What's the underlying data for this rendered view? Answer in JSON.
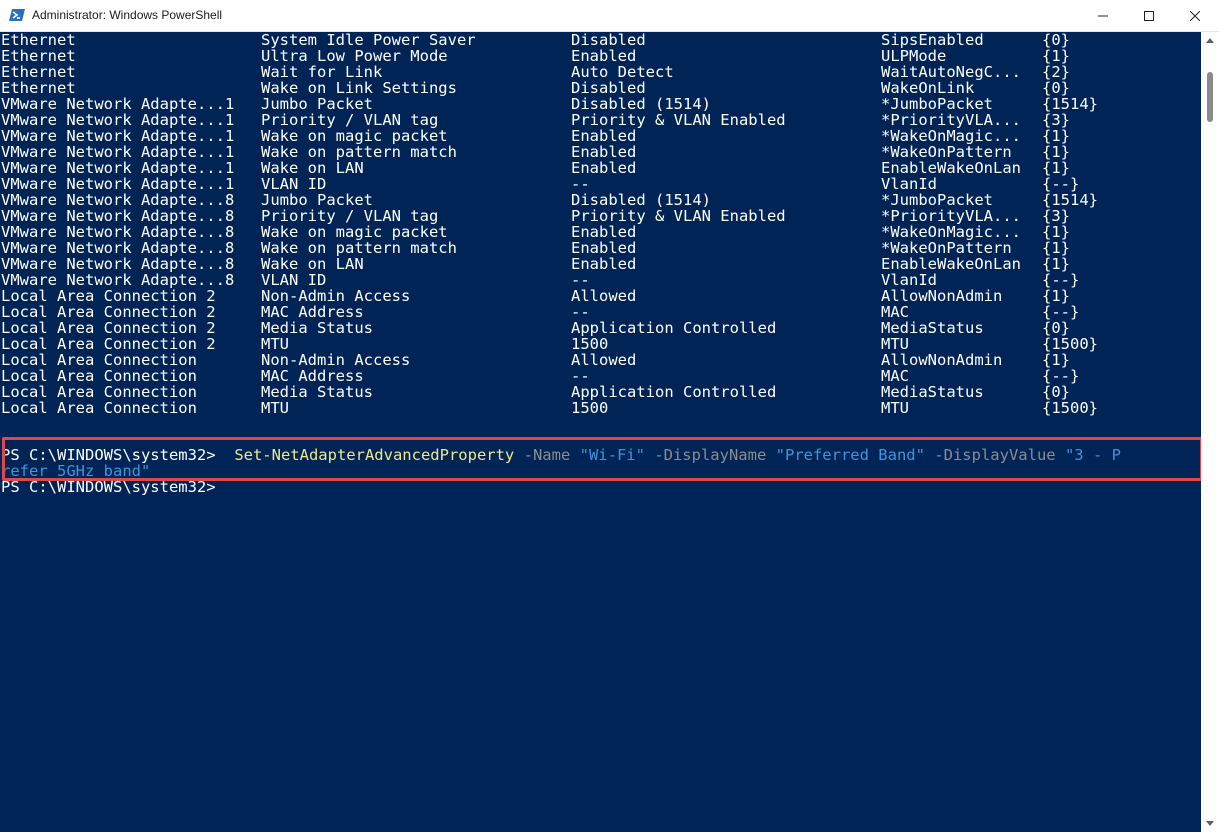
{
  "window": {
    "title": "Administrator: Windows PowerShell",
    "icon": "powershell-icon",
    "controls": [
      "minimize-icon",
      "maximize-icon",
      "close-icon"
    ]
  },
  "colors": {
    "background": "#012456",
    "text": "#ffffff",
    "cmdlet": "#f0e68c",
    "parameter": "#8c8c8c",
    "string": "#3a96dd",
    "highlight_border": "#e0474b"
  },
  "output_rows": [
    [
      "Ethernet",
      "System Idle Power Saver",
      "Disabled",
      "SipsEnabled",
      "{0}"
    ],
    [
      "Ethernet",
      "Ultra Low Power Mode",
      "Enabled",
      "ULPMode",
      "{1}"
    ],
    [
      "Ethernet",
      "Wait for Link",
      "Auto Detect",
      "WaitAutoNegC...",
      "{2}"
    ],
    [
      "Ethernet",
      "Wake on Link Settings",
      "Disabled",
      "WakeOnLink",
      "{0}"
    ],
    [
      "VMware Network Adapte...1",
      "Jumbo Packet",
      "Disabled (1514)",
      "*JumboPacket",
      "{1514}"
    ],
    [
      "VMware Network Adapte...1",
      "Priority / VLAN tag",
      "Priority & VLAN Enabled",
      "*PriorityVLA...",
      "{3}"
    ],
    [
      "VMware Network Adapte...1",
      "Wake on magic packet",
      "Enabled",
      "*WakeOnMagic...",
      "{1}"
    ],
    [
      "VMware Network Adapte...1",
      "Wake on pattern match",
      "Enabled",
      "*WakeOnPattern",
      "{1}"
    ],
    [
      "VMware Network Adapte...1",
      "Wake on LAN",
      "Enabled",
      "EnableWakeOnLan",
      "{1}"
    ],
    [
      "VMware Network Adapte...1",
      "VLAN ID",
      "--",
      "VlanId",
      "{--}"
    ],
    [
      "VMware Network Adapte...8",
      "Jumbo Packet",
      "Disabled (1514)",
      "*JumboPacket",
      "{1514}"
    ],
    [
      "VMware Network Adapte...8",
      "Priority / VLAN tag",
      "Priority & VLAN Enabled",
      "*PriorityVLA...",
      "{3}"
    ],
    [
      "VMware Network Adapte...8",
      "Wake on magic packet",
      "Enabled",
      "*WakeOnMagic...",
      "{1}"
    ],
    [
      "VMware Network Adapte...8",
      "Wake on pattern match",
      "Enabled",
      "*WakeOnPattern",
      "{1}"
    ],
    [
      "VMware Network Adapte...8",
      "Wake on LAN",
      "Enabled",
      "EnableWakeOnLan",
      "{1}"
    ],
    [
      "VMware Network Adapte...8",
      "VLAN ID",
      "--",
      "VlanId",
      "{--}"
    ],
    [
      "Local Area Connection 2",
      "Non-Admin Access",
      "Allowed",
      "AllowNonAdmin",
      "{1}"
    ],
    [
      "Local Area Connection 2",
      "MAC Address",
      "--",
      "MAC",
      "{--}"
    ],
    [
      "Local Area Connection 2",
      "Media Status",
      "Application Controlled",
      "MediaStatus",
      "{0}"
    ],
    [
      "Local Area Connection 2",
      "MTU",
      "1500",
      "MTU",
      "{1500}"
    ],
    [
      "Local Area Connection",
      "Non-Admin Access",
      "Allowed",
      "AllowNonAdmin",
      "{1}"
    ],
    [
      "Local Area Connection",
      "MAC Address",
      "--",
      "MAC",
      "{--}"
    ],
    [
      "Local Area Connection",
      "Media Status",
      "Application Controlled",
      "MediaStatus",
      "{0}"
    ],
    [
      "Local Area Connection",
      "MTU",
      "1500",
      "MTU",
      "{1500}"
    ]
  ],
  "command": {
    "prompt": "PS C:\\WINDOWS\\system32>",
    "cmdlet": "Set-NetAdapterAdvancedProperty",
    "param_name": "-Name",
    "value_name": "\"Wi-Fi\"",
    "param_display_name": "-DisplayName",
    "value_display_name": "\"Preferred Band\"",
    "param_display_value": "-DisplayValue",
    "value_display_value_part1": "\"3 - P",
    "value_display_value_part2": "refer 5GHz band\""
  },
  "next_prompt": "PS C:\\WINDOWS\\system32>"
}
